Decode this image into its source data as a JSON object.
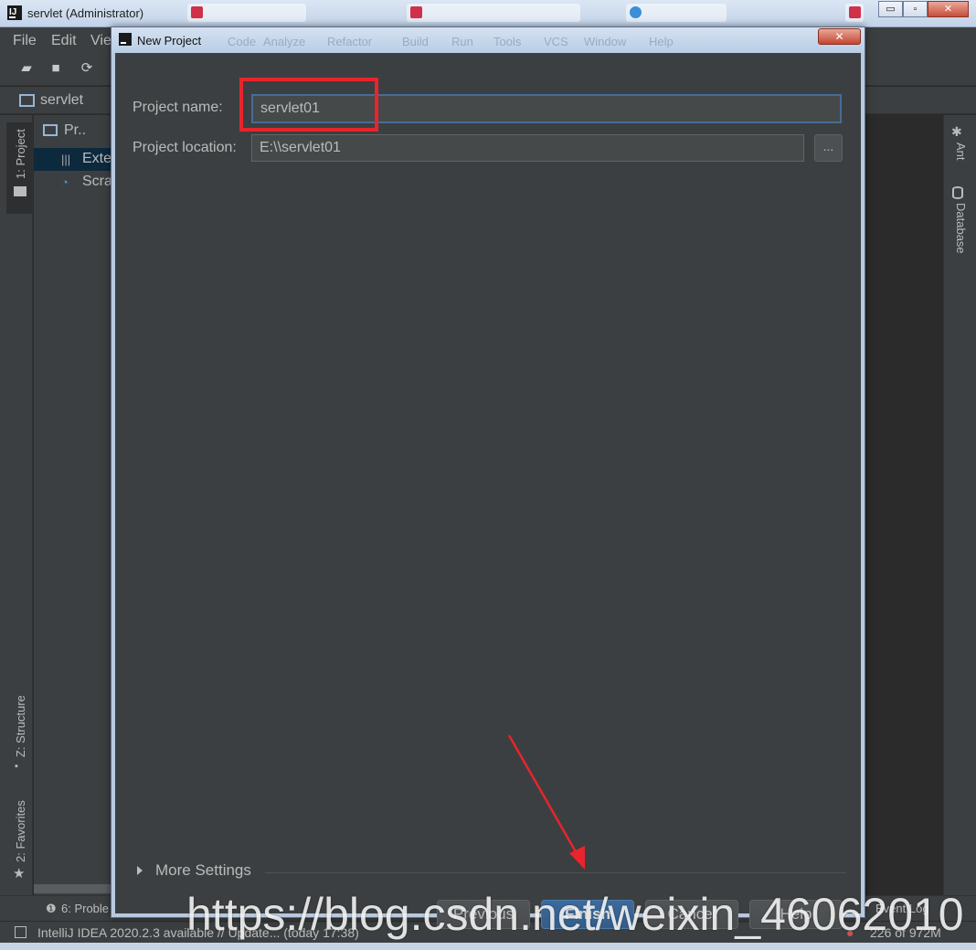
{
  "window": {
    "title": "servlet (Administrator)",
    "controls": {
      "minimize": "▭",
      "maximize": "▫",
      "close": "✕"
    }
  },
  "menubar": {
    "items": [
      "File",
      "Edit",
      "Vie"
    ],
    "ghost_items": [
      "Code",
      "Analyze",
      "Refactor",
      "Build",
      "Run",
      "Tools",
      "VCS",
      "Window",
      "Help"
    ]
  },
  "navbar": {
    "project": "servlet"
  },
  "left_strip": {
    "project_tab": "1: Project",
    "structure_tab": "Z: Structure",
    "favorites_tab": "2: Favorites"
  },
  "project_panel": {
    "header": "Pr..",
    "rows": [
      {
        "icon": "library-icon",
        "label": "Exte"
      },
      {
        "icon": "scratches-icon",
        "label": "Scra"
      }
    ]
  },
  "right_strip": {
    "ant_tab": "Ant",
    "database_tab": "Database"
  },
  "dialog": {
    "title": "New Project",
    "ghost_menu": [
      "Code",
      "Analyze",
      "Refactor",
      "Build",
      "Run",
      "Tools",
      "VCS",
      "Window",
      "Help"
    ],
    "project_name_label": "Project name:",
    "project_name_value": "servlet01",
    "project_location_label": "Project location:",
    "project_location_value": "E:\\\\servlet01",
    "browse_label": "...",
    "more_settings": "More Settings",
    "buttons": {
      "previous": "Previous",
      "finish": "Finish",
      "cancel": "Cancel",
      "help": "Help"
    }
  },
  "bottom_tool": {
    "problems": "6: Proble",
    "event_log": "Event Log"
  },
  "statusbar": {
    "message": "IntelliJ IDEA 2020.2.3 available // Update... (today 17:38)",
    "memory": "226 of 972M"
  },
  "watermark": "https://blog.csdn.net/weixin_46062010",
  "colors": {
    "ide_bg": "#3c3f41",
    "editor_bg": "#2b2b2b",
    "accent_blue": "#365880",
    "annotation_red": "#e8242c"
  }
}
